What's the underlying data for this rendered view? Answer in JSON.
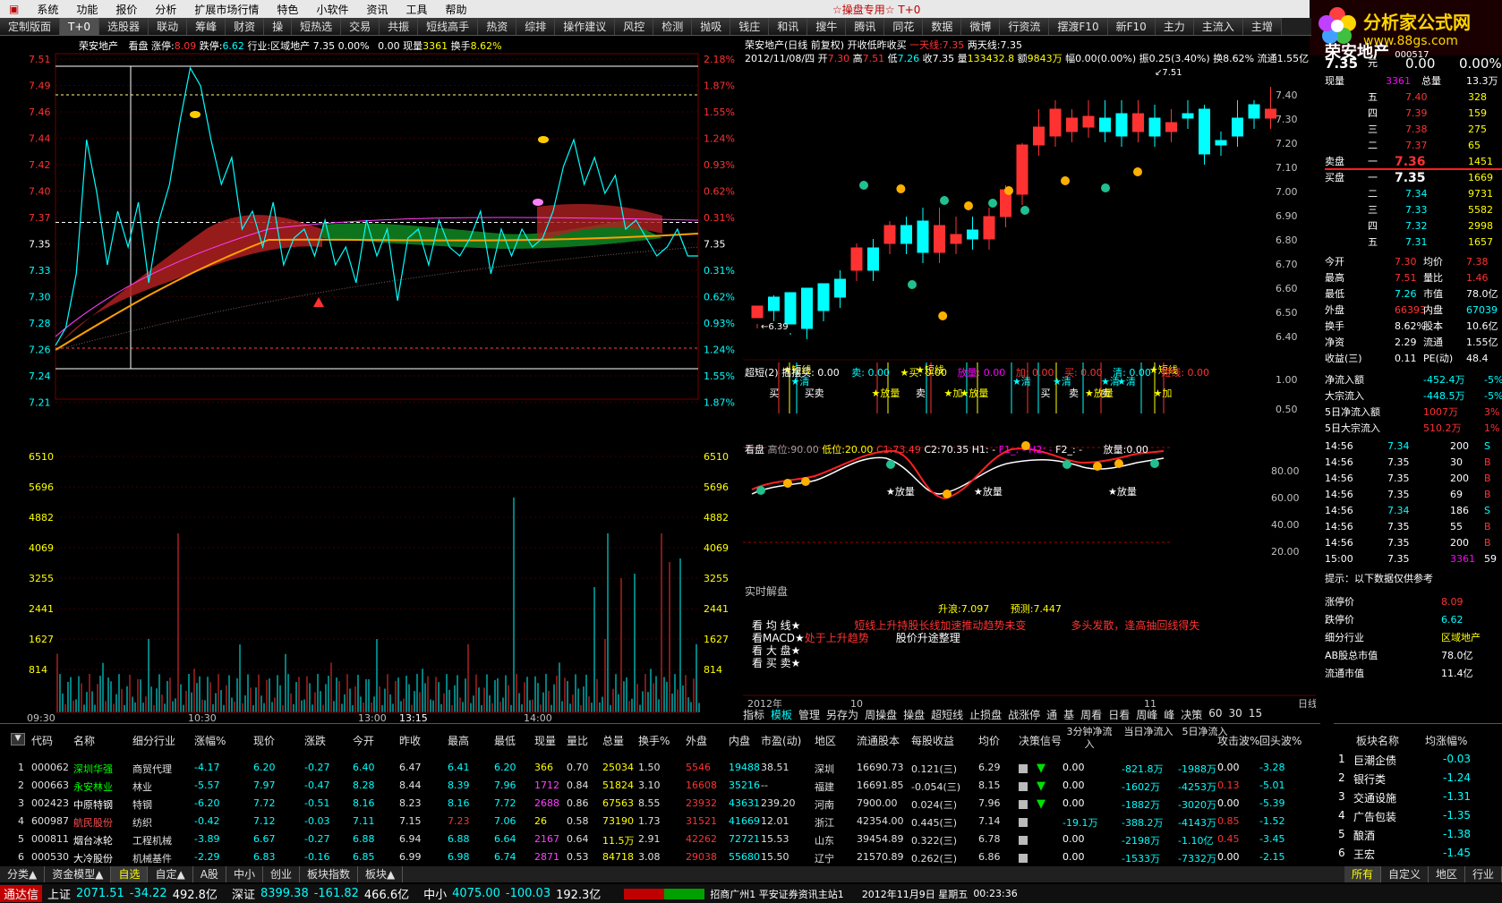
{
  "menu": {
    "items": [
      "系统",
      "功能",
      "报价",
      "分析",
      "扩展市场行情",
      "特色",
      "小软件",
      "资讯",
      "工具",
      "帮助"
    ],
    "title": "☆操盘专用☆",
    "mode": "T+0"
  },
  "logo": {
    "line1": "分析家公式网",
    "line2": "www.88gs.com"
  },
  "tabs": [
    "定制版面",
    "T+0",
    "选股器",
    "联动",
    "筹峰",
    "财资",
    "操",
    "短热选",
    "交易",
    "共振",
    "短线高手",
    "热资",
    "综排",
    "操作建议",
    "风控",
    "检测",
    "抛吸",
    "钱庄",
    "和讯",
    "搜牛",
    "腾讯",
    "同花",
    "数据",
    "微博",
    "行资流",
    "摆渡F10",
    "新F10",
    "主力",
    "主流入",
    "主增"
  ],
  "intraday": {
    "header": {
      "name": "荣安地产",
      "view": "看盘",
      "zt_label": "涨停:",
      "zt": "8.09",
      "dt_label": "跌停:",
      "dt": "6.62",
      "ind_label": "行业:",
      "ind": "区域地产",
      "price": "7.35",
      "pct": "0.00%",
      "chg": "0.00",
      "vol_label": "现量",
      "vol": "3361",
      "turn_label": "换手",
      "turn": "8.62%"
    },
    "left_ticks": [
      "7.51",
      "7.49",
      "7.46",
      "7.44",
      "7.42",
      "7.40",
      "7.37",
      "7.35",
      "7.33",
      "7.30",
      "7.28",
      "7.26",
      "7.24",
      "7.21"
    ],
    "right_ticks": [
      "2.18%",
      "1.87%",
      "1.55%",
      "1.24%",
      "0.93%",
      "0.62%",
      "0.31%",
      "0.31%",
      "0.62%",
      "0.93%",
      "1.24%",
      "1.55%",
      "1.87%"
    ],
    "last_price": "7.35",
    "vol_ticks": [
      "6510",
      "5696",
      "4882",
      "4069",
      "3255",
      "2441",
      "1627",
      "814"
    ],
    "time_ticks": [
      "09:30",
      "10:30",
      "13:00",
      "13:15",
      "14:00"
    ]
  },
  "kline": {
    "header1": "荣安地产(日线 前复权) 开收低昨收买",
    "ma1_label": "一天线:",
    "ma1": "7.35",
    "ma2_label": "两天线:",
    "ma2": "7.35",
    "header2_date": "2012/11/08/四",
    "open_label": "开",
    "open": "7.30",
    "high_label": "高",
    "high": "7.51",
    "low_label": "低",
    "low": "7.26",
    "close_label": "收",
    "close": "7.35",
    "vol_label": "量",
    "vol": "133432.8",
    "amt_label": "额",
    "amt": "9843万",
    "amp_label": "幅",
    "amp": "0.00(0.00%)",
    "zf_label": "振",
    "zf": "0.25(3.40%)",
    "hs_label": "换",
    "hs": "8.62%",
    "lt_label": "流通",
    "lt": "1.55亿",
    "marker_high": "7.51",
    "marker_low": "6.39",
    "super_line": "超短(2) 摇摆买: 0.00",
    "super_items": [
      "卖: 0.00",
      "★买: 0.00",
      "放量: 0.00",
      "加: 0.00",
      "买: 0.00",
      "清: 0.00",
      "短线: 0.00"
    ],
    "signal_labels": [
      "★短线",
      "★清",
      "买",
      "卖",
      "买",
      "★放量",
      "★短线",
      "卖",
      "★加",
      "★放量",
      "★清",
      "买",
      "★清",
      "卖",
      "卖",
      "★清",
      "★放量",
      "★清",
      "★短线",
      "★加"
    ],
    "osc_header": {
      "title": "看盘",
      "high_label": "高位:",
      "high": "90.00",
      "low_label": "低位:",
      "low": "20.00",
      "c1_label": "C1:",
      "c1": "73.49",
      "c2_label": "C2:",
      "c2": "70.35",
      "h1": "H1: -",
      "f1": "F1_: -",
      "h2": "H2: -",
      "f2": "F2_: -",
      "vol_label": "放量:",
      "vol": "0.00"
    },
    "osc_ticks": [
      "80.00",
      "60.00",
      "40.00",
      "20.00"
    ],
    "osc_labels": [
      "★放量",
      "★放量",
      "★放量"
    ],
    "analysis_title": "实时解盘",
    "rise_label": "升浪:",
    "rise": "7.097",
    "pred_label": "预测:",
    "pred": "7.447",
    "analysis": [
      {
        "k": "看 均 线★",
        "v": "短线上升持股长线加速推动趋势未变",
        "v2": "多头发散，逢高抽回线得失"
      },
      {
        "k": "看MACD★",
        "v": "处于上升趋势",
        "v2": "股价升途整理"
      },
      {
        "k": "看 大 盘★",
        "v": ""
      },
      {
        "k": "看 买 卖★",
        "v": ""
      }
    ],
    "axis_left": [
      "7.40",
      "7.30",
      "7.20",
      "7.10",
      "7.00",
      "6.90",
      "6.80",
      "6.70",
      "6.60",
      "6.50",
      "6.40",
      "1.00",
      "0.50"
    ],
    "date_axis": [
      "2012年",
      "10",
      "11",
      "日线"
    ],
    "bottom_tools": [
      "指标",
      "模板",
      "管理",
      "另存为",
      "周操盘",
      "操盘",
      "超短线",
      "止损盘",
      "战涨停",
      "通",
      "基",
      "周看",
      "日看",
      "周峰",
      "峰",
      "决策",
      "60",
      "30",
      "15"
    ]
  },
  "quote": {
    "name": "荣安地产",
    "code": "000517",
    "price": "7.35",
    "price_unit": "元",
    "chg": "0.00",
    "pct": "0.00%",
    "xl_label": "现量",
    "xl": "3361",
    "zl_label": "总量",
    "zl": "13.3万",
    "sell": [
      {
        "k": "五",
        "p": "7.40",
        "v": "328"
      },
      {
        "k": "四",
        "p": "7.39",
        "v": "159"
      },
      {
        "k": "三",
        "p": "7.38",
        "v": "275"
      },
      {
        "k": "二",
        "p": "7.37",
        "v": "65"
      },
      {
        "k": "一",
        "p": "7.36",
        "v": "1451"
      }
    ],
    "buy": [
      {
        "k": "一",
        "p": "7.35",
        "v": "1669"
      },
      {
        "k": "二",
        "p": "7.34",
        "v": "9731"
      },
      {
        "k": "三",
        "p": "7.33",
        "v": "5582"
      },
      {
        "k": "四",
        "p": "7.32",
        "v": "2998"
      },
      {
        "k": "五",
        "p": "7.31",
        "v": "1657"
      }
    ],
    "sell_label": "卖盘",
    "buy_label": "买盘",
    "stats": [
      {
        "k": "今开",
        "v": "7.30",
        "k2": "均价",
        "v2": "7.38"
      },
      {
        "k": "最高",
        "v": "7.51",
        "k2": "量比",
        "v2": "1.46"
      },
      {
        "k": "最低",
        "v": "7.26",
        "k2": "市值",
        "v2": "78.0亿"
      },
      {
        "k": "外盘",
        "v": "66393",
        "k2": "内盘",
        "v2": "67039"
      },
      {
        "k": "换手",
        "v": "8.62%",
        "k2": "股本",
        "v2": "10.6亿"
      },
      {
        "k": "净资",
        "v": "2.29",
        "k2": "流通",
        "v2": "1.55亿"
      },
      {
        "k": "收益(三)",
        "v": "0.11",
        "k2": "PE(动)",
        "v2": "48.4"
      }
    ],
    "flows": [
      {
        "k": "净流入额",
        "v": "-452.4万",
        "p": "-5%"
      },
      {
        "k": "大宗流入",
        "v": "-448.5万",
        "p": "-5%"
      },
      {
        "k": "5日净流入额",
        "v": "1007万",
        "p": "3%"
      },
      {
        "k": "5日大宗流入",
        "v": "510.2万",
        "p": "1%"
      }
    ],
    "ticks": [
      {
        "t": "14:56",
        "p": "7.34",
        "v": "200",
        "d": "S"
      },
      {
        "t": "14:56",
        "p": "7.35",
        "v": "30",
        "d": "B"
      },
      {
        "t": "14:56",
        "p": "7.35",
        "v": "200",
        "d": "B"
      },
      {
        "t": "14:56",
        "p": "7.35",
        "v": "69",
        "d": "B"
      },
      {
        "t": "14:56",
        "p": "7.34",
        "v": "186",
        "d": "S"
      },
      {
        "t": "14:56",
        "p": "7.35",
        "v": "55",
        "d": "B"
      },
      {
        "t": "14:56",
        "p": "7.35",
        "v": "200",
        "d": "B"
      },
      {
        "t": "15:00",
        "p": "7.35",
        "v": "3361",
        "d": "59"
      }
    ],
    "hint": "提示：以下数据仅供参考",
    "extra": [
      {
        "k": "涨停价",
        "v": "8.09"
      },
      {
        "k": "跌停价",
        "v": "6.62"
      },
      {
        "k": "细分行业",
        "v": "区域地产"
      },
      {
        "k": "AB股总市值",
        "v": "78.0亿"
      },
      {
        "k": "流通市值",
        "v": "11.4亿"
      }
    ],
    "side_ticks": [
      "7.40",
      "7.30",
      "7.20",
      "7.10",
      "7.00",
      "6.90",
      "6.80",
      "6.70",
      "6.60",
      "6.50",
      "6.40",
      "1.00",
      "0.50"
    ]
  },
  "table": {
    "headers": [
      "代码",
      "名称",
      "细分行业",
      "涨幅%",
      "现价",
      "涨跌",
      "今开",
      "昨收",
      "最高",
      "最低",
      "现量",
      "量比",
      "总量",
      "换手%",
      "外盘",
      "内盘",
      "市盈(动)",
      "地区",
      "流通股本",
      "每股收益",
      "均价",
      "决策信号",
      "3分钟净流入",
      "当日净流入",
      "5日净流入",
      "攻击波%",
      "回头波%"
    ],
    "rows": [
      [
        "1",
        "000062",
        "深圳华强",
        "商贸代理",
        "-4.17",
        "6.20",
        "-0.27",
        "6.40",
        "6.47",
        "6.41",
        "6.20",
        "366",
        "0.70",
        "25034",
        "1.50",
        "5546",
        "19488",
        "38.51",
        "深圳",
        "16690.73",
        "0.121(三)",
        "6.29",
        "",
        "0.00",
        "-821.8万",
        "-1988万",
        "0.00",
        "-3.28"
      ],
      [
        "2",
        "000663",
        "永安林业",
        "林业",
        "-5.57",
        "7.97",
        "-0.47",
        "8.28",
        "8.44",
        "8.39",
        "7.96",
        "1712",
        "0.84",
        "51824",
        "3.10",
        "16608",
        "35216",
        "--",
        "福建",
        "16691.85",
        "-0.054(三)",
        "8.15",
        "",
        "0.00",
        "-1602万",
        "-4253万",
        "0.13",
        "-5.01"
      ],
      [
        "3",
        "002423",
        "中原特钢",
        "特钢",
        "-6.20",
        "7.72",
        "-0.51",
        "8.16",
        "8.23",
        "8.16",
        "7.72",
        "2688",
        "0.86",
        "67563",
        "8.55",
        "23932",
        "43631",
        "239.20",
        "河南",
        "7900.00",
        "0.024(三)",
        "7.96",
        "",
        "0.00",
        "-1882万",
        "-3020万",
        "0.00",
        "-5.39"
      ],
      [
        "4",
        "600987",
        "航民股份",
        "纺织",
        "-0.42",
        "7.12",
        "-0.03",
        "7.11",
        "7.15",
        "7.23",
        "7.06",
        "26",
        "0.58",
        "73190",
        "1.73",
        "31521",
        "41669",
        "12.01",
        "浙江",
        "42354.00",
        "0.445(三)",
        "7.14",
        "",
        "-19.1万",
        "-388.2万",
        "-4143万",
        "0.85",
        "-1.52"
      ],
      [
        "5",
        "000811",
        "烟台冰轮",
        "工程机械",
        "-3.89",
        "6.67",
        "-0.27",
        "6.88",
        "6.94",
        "6.88",
        "6.64",
        "2167",
        "0.64",
        "11.5万",
        "2.91",
        "42262",
        "72721",
        "15.53",
        "山东",
        "39454.89",
        "0.322(三)",
        "6.78",
        "",
        "0.00",
        "-2198万",
        "-1.10亿",
        "0.45",
        "-3.45"
      ],
      [
        "6",
        "000530",
        "大冷股份",
        "机械基件",
        "-2.29",
        "6.83",
        "-0.16",
        "6.85",
        "6.99",
        "6.98",
        "6.74",
        "2871",
        "0.53",
        "84718",
        "3.08",
        "29038",
        "55680",
        "15.50",
        "辽宁",
        "21570.89",
        "0.262(三)",
        "6.86",
        "",
        "0.00",
        "-1533万",
        "-7332万",
        "0.00",
        "-2.15"
      ]
    ]
  },
  "bk": {
    "headers": [
      "板块名称",
      "均涨幅%"
    ],
    "rows": [
      [
        "1",
        "巨潮企债",
        "-0.03"
      ],
      [
        "2",
        "银行类",
        "-1.24"
      ],
      [
        "3",
        "交通设施",
        "-1.31"
      ],
      [
        "4",
        "广告包装",
        "-1.35"
      ],
      [
        "5",
        "酿酒",
        "-1.38"
      ],
      [
        "6",
        "王宏",
        "-1.45"
      ]
    ]
  },
  "bottom_tabs": [
    "分类▲",
    "资金模型▲",
    "自选",
    "自定▲",
    "A股",
    "中小",
    "创业",
    "板块指数",
    "板块▲"
  ],
  "bottom_tabs_right": [
    "所有",
    "自定义",
    "地区",
    "行业"
  ],
  "status": {
    "brand": "通达信",
    "sh_label": "上证",
    "sh": "2071.51",
    "sh_chg": "-34.22",
    "sh_amt": "492.8亿",
    "sz_label": "深证",
    "sz": "8399.38",
    "sz_chg": "-161.82",
    "sz_amt": "466.6亿",
    "zx_label": "中小",
    "zx": "4075.00",
    "zx_chg": "-100.03",
    "zx_amt": "192.3亿",
    "server": "招商广州1 平安证券资讯主站1",
    "date": "2012年11月9日 星期五",
    "time": "00:23:36"
  },
  "colors": {
    "up": "#ff3232",
    "down": "#00ffff",
    "bg": "#000000",
    "accent": "#ffff00"
  }
}
